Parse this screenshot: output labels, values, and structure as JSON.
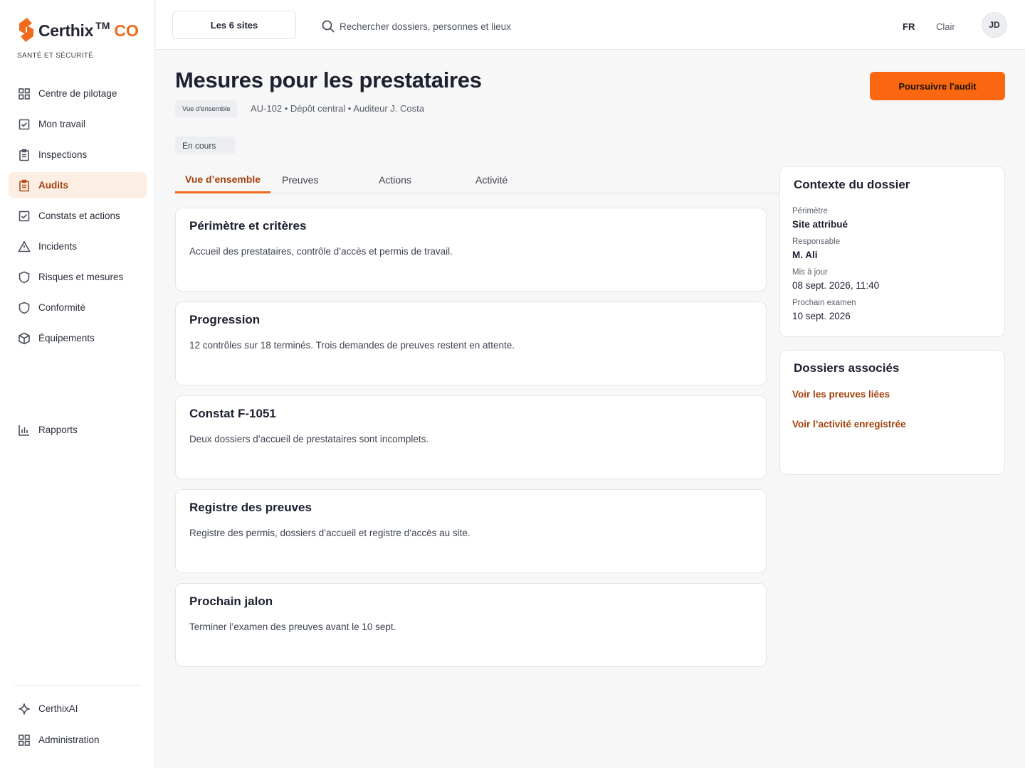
{
  "brand": {
    "name": "Certhix",
    "tm": "TM",
    "suffix": "CO",
    "subtitle": "SANTÉ ET SÉCURITÉ",
    "accent": "#f26a1b"
  },
  "sidebar": {
    "items": [
      {
        "label": "Centre de pilotage",
        "icon": "grid-icon"
      },
      {
        "label": "Mon travail",
        "icon": "checkbox-icon"
      },
      {
        "label": "Inspections",
        "icon": "clipboard-icon"
      },
      {
        "label": "Audits",
        "icon": "clipboard-icon",
        "active": true
      },
      {
        "label": "Constats et actions",
        "icon": "checkbox-icon"
      },
      {
        "label": "Incidents",
        "icon": "warning-icon"
      },
      {
        "label": "Risques et mesures",
        "icon": "shield-icon"
      },
      {
        "label": "Conformité",
        "icon": "shield-icon"
      },
      {
        "label": "Équipements",
        "icon": "box-icon"
      },
      {
        "label": "Rapports",
        "icon": "bar-chart-icon"
      }
    ],
    "footer": [
      {
        "label": "CerthixAI",
        "icon": "sparkle-icon"
      },
      {
        "label": "Administration",
        "icon": "grid-icon"
      }
    ]
  },
  "topbar": {
    "sites_label": "Les 6 sites",
    "search_placeholder": "Rechercher dossiers, personnes et lieux",
    "lang": "FR",
    "theme": "Clair",
    "avatar": "JD"
  },
  "header": {
    "title": "Mesures pour les prestataires",
    "overview_chip": "Vue d'ensemble",
    "meta": "AU-102 • Dépôt central • Auditeur J. Costa",
    "status": "En cours",
    "primary_action": "Poursuivre l'audit"
  },
  "tabs": [
    {
      "label": "Vue d’ensemble",
      "active": true
    },
    {
      "label": "Preuves"
    },
    {
      "label": "Actions"
    },
    {
      "label": "Activité"
    }
  ],
  "cards": [
    {
      "title": "Périmètre et critères",
      "text": "Accueil des prestataires, contrôle d’accès et permis de travail."
    },
    {
      "title": "Progression",
      "text": "12 contrôles sur 18 terminés. Trois demandes de preuves restent en attente."
    },
    {
      "title": "Constat F-1051",
      "text": "Deux dossiers d’accueil de prestataires sont incomplets."
    },
    {
      "title": "Registre des preuves",
      "text": "Registre des permis, dossiers d’accueil et registre d’accès au site."
    },
    {
      "title": "Prochain jalon",
      "text": "Terminer l’examen des preuves avant le 10 sept."
    }
  ],
  "context": {
    "title": "Contexte du dossier",
    "fields": [
      {
        "label": "Périmètre",
        "value": "Site attribué"
      },
      {
        "label": "Responsable",
        "value": "M. Ali"
      },
      {
        "label": "Mis à jour",
        "value": "08 sept. 2026, 11:40"
      },
      {
        "label": "Prochain examen",
        "value": "10 sept. 2026"
      }
    ]
  },
  "related": {
    "title": "Dossiers associés",
    "links": [
      "Voir les preuves liées",
      "Voir l’activité enregistrée"
    ]
  }
}
